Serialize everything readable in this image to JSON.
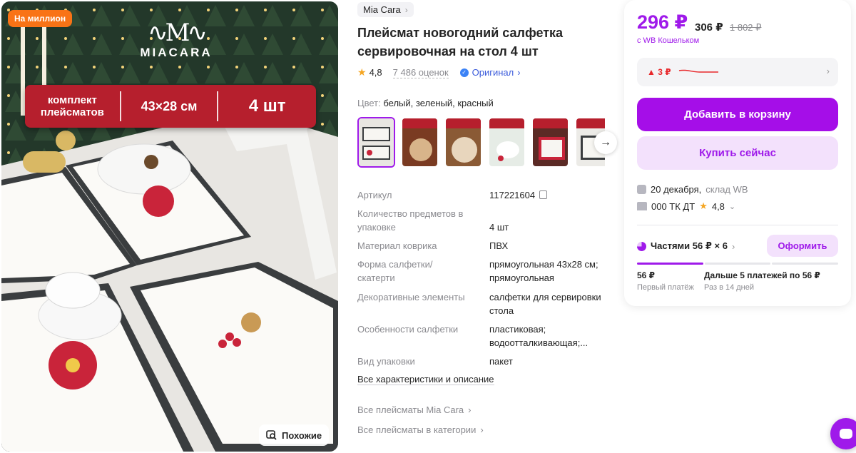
{
  "gallery": {
    "badge": "На миллион",
    "brand_logo_mark": "∿M∿",
    "brand_logo_word": "MIACARA",
    "banner": {
      "kit": "комплект плейсматов",
      "size": "43×28 см",
      "qty": "4 шт"
    },
    "similar_label": "Похожие",
    "similar_icon": "search-image-icon"
  },
  "product": {
    "brand": "Mia Cara",
    "title": "Плейсмат новогодний салфетка сервировочная на стол 4 шт",
    "rating": "4,8",
    "reviews": "7 486 оценок",
    "original": "Оригинал",
    "color_label": "Цвет:",
    "color_value": "белый, зеленый, красный",
    "thumbnail_count": 6
  },
  "specs": [
    {
      "key": "Артикул",
      "value": "117221604"
    },
    {
      "key": "Количество предметов в упаковке",
      "value": "4 шт"
    },
    {
      "key": "Материал коврика",
      "value": "ПВХ"
    },
    {
      "key": "Форма салфетки/скатерти",
      "value": "прямоугольная 43х28 см; прямоугольная"
    },
    {
      "key": "Декоративные элементы",
      "value": "салфетки для сервировки стола"
    },
    {
      "key": "Особенности салфетки",
      "value": "пластиковая; водоотталкивающая;..."
    },
    {
      "key": "Вид упаковки",
      "value": "пакет"
    }
  ],
  "links": {
    "all_specs": "Все характеристики и описание",
    "all_brand": "Все плейсматы Mia Cara",
    "all_category": "Все плейсматы в категории"
  },
  "purchase": {
    "price": "296 ₽",
    "price_regular": "306 ₽",
    "price_old": "1 802 ₽",
    "wallet_note": "с WB Кошельком",
    "price_change": "▲ 3 ₽",
    "add_to_cart": "Добавить в корзину",
    "buy_now": "Купить сейчас",
    "delivery_date": "20 декабря,",
    "warehouse": "склад WB",
    "seller": "000 ТК ДТ",
    "seller_rating": "4,8",
    "installments": "Частями 56 ₽ × 6",
    "order_button": "Оформить",
    "installment_progress": 0.333,
    "first_payment_amount": "56 ₽",
    "first_payment_label": "Первый платёж",
    "next_payments": "Дальше 5 платежей по 56 ₽",
    "next_payments_label": "Раз в 14 дней"
  },
  "colors": {
    "accent": "#9f1aea",
    "accent_light": "#f3e1fc",
    "badge_orange": "#f97316",
    "banner_red": "#b61f2d",
    "price_up": "#e8282b"
  }
}
